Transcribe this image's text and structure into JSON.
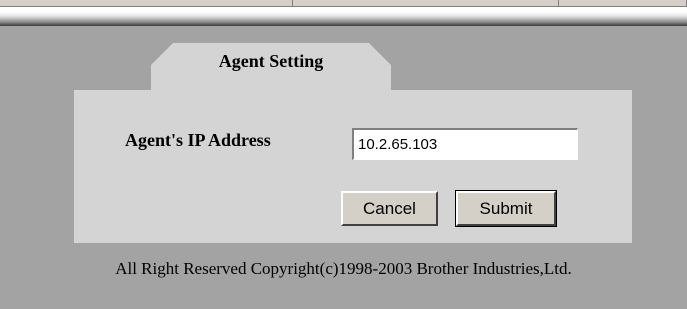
{
  "form": {
    "tab_title": "Agent Setting",
    "ip_label": "Agent's IP Address",
    "ip_value": "10.2.65.103",
    "cancel_label": "Cancel",
    "submit_label": "Submit"
  },
  "footer": {
    "copyright": "All Right Reserved Copyright(c)1998-2003 Brother Industries,Ltd."
  },
  "colors": {
    "page_background": "#a3a3a3",
    "panel_background": "#d4d4d4",
    "button_face": "#d4d0c8"
  }
}
